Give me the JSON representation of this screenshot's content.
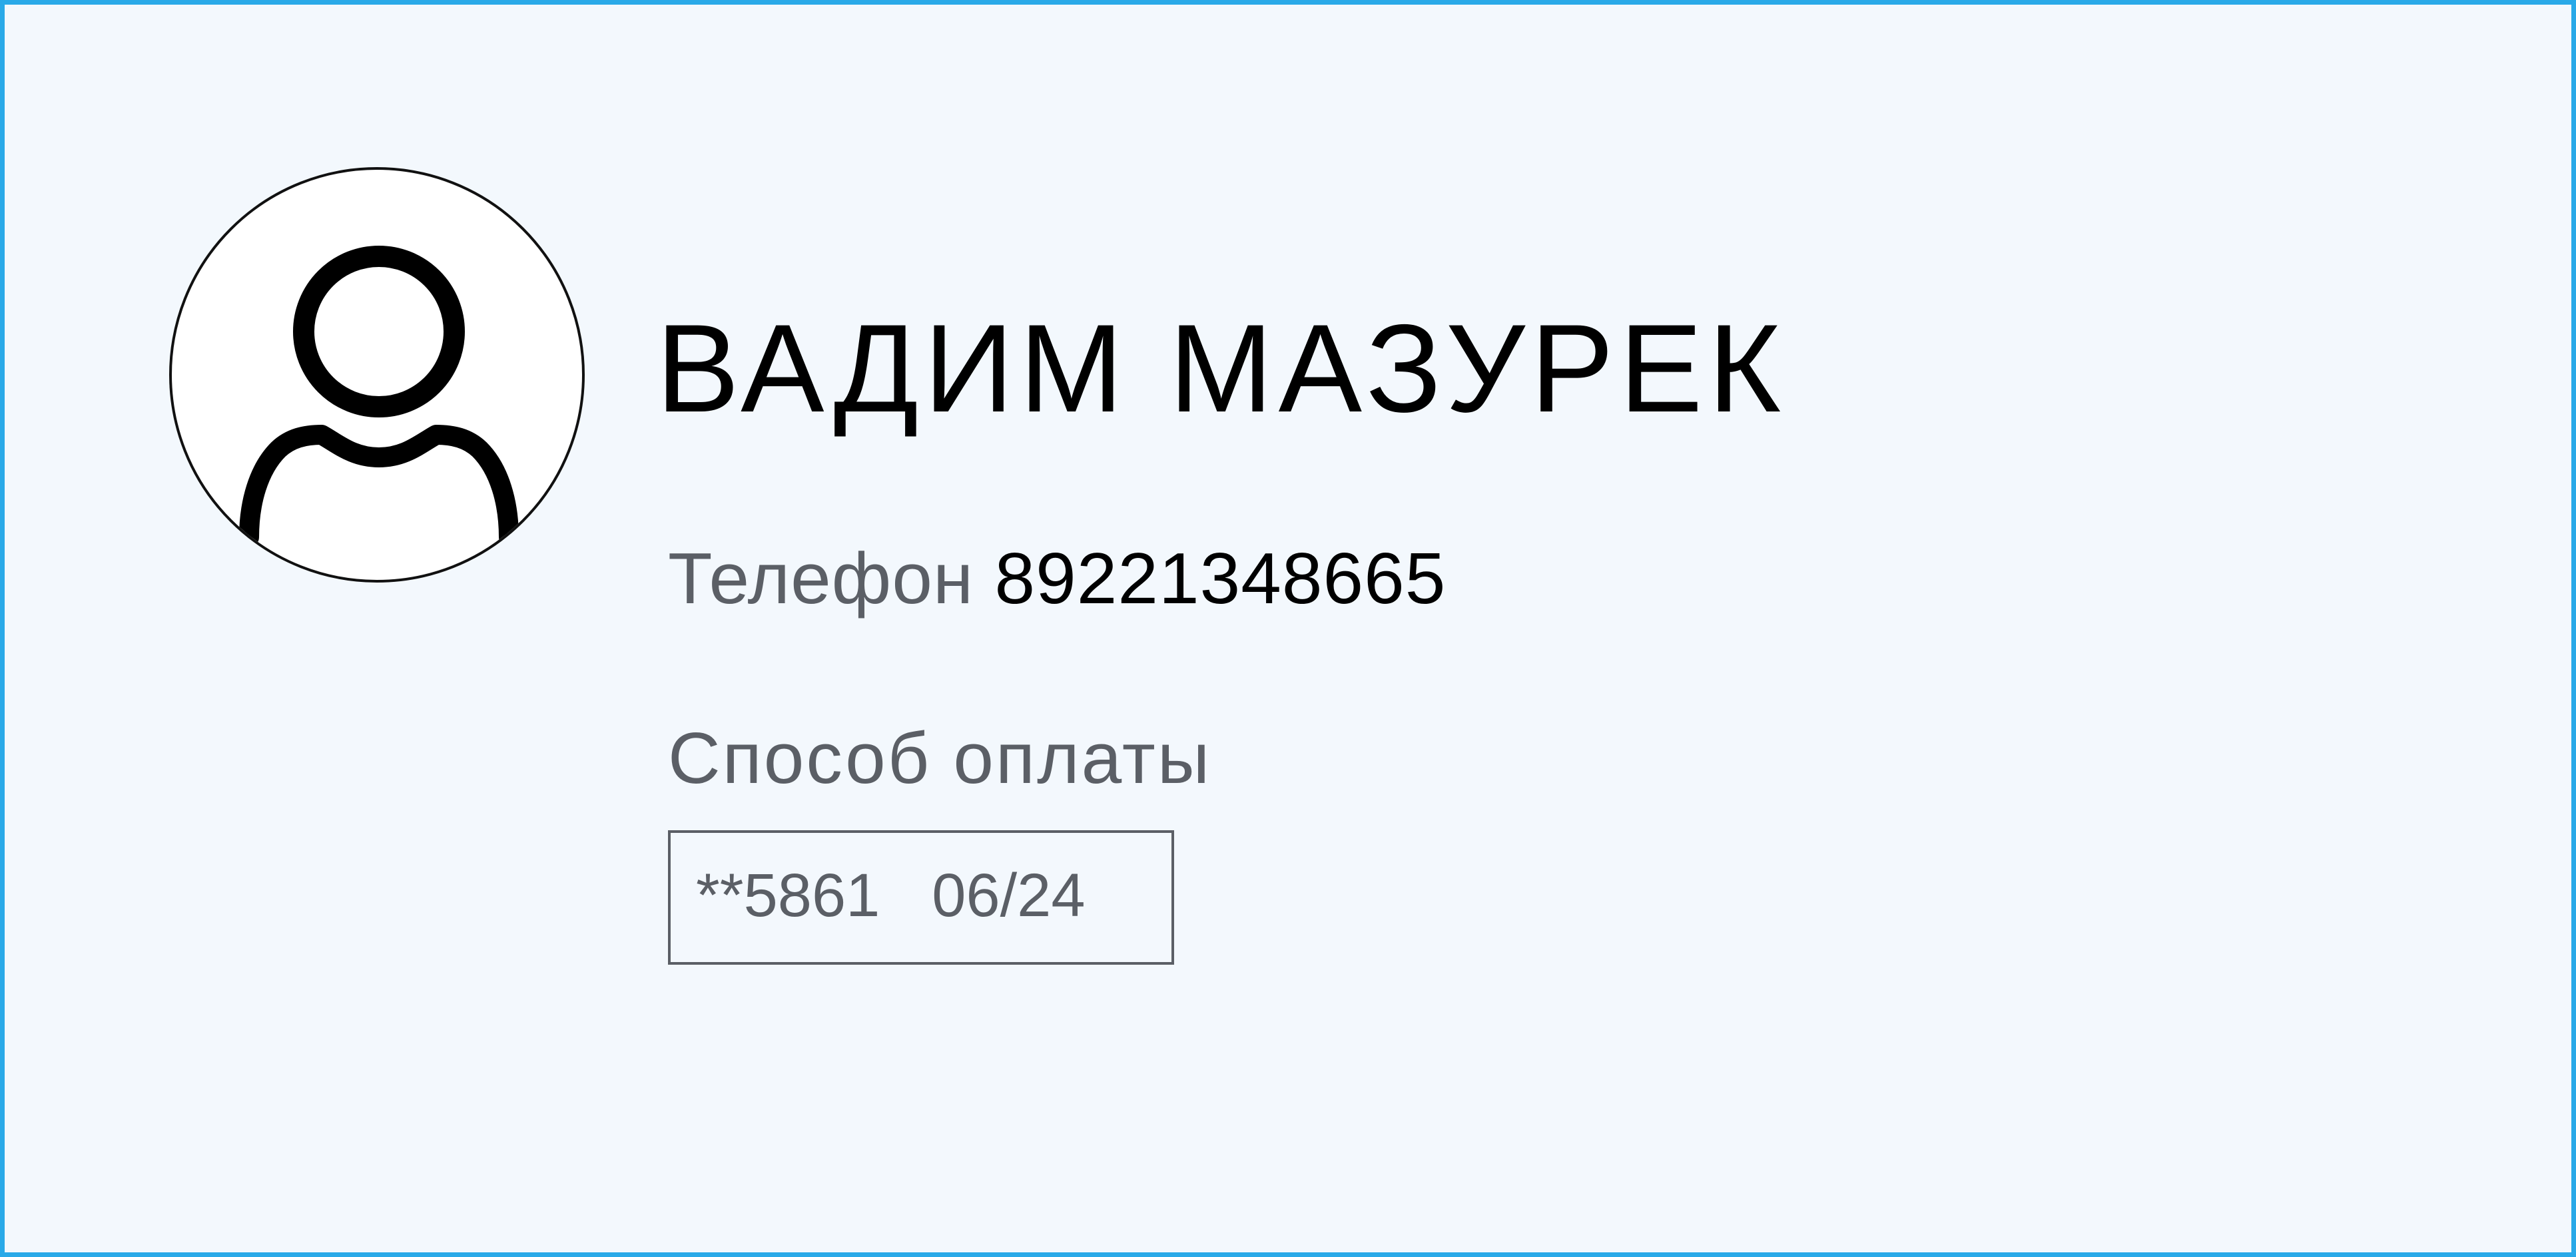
{
  "profile": {
    "name": "ВАДИМ МАЗУРЕК",
    "phone_label": "Телефон",
    "phone_value": "89221348665",
    "payment_title": "Способ оплаты",
    "card_number": "**5861",
    "card_expiry": "06/24",
    "avatar_icon": "user-avatar-icon"
  },
  "colors": {
    "border_accent": "#29a9e8",
    "background": "#f3f8fd",
    "muted_text": "#5b5f66",
    "primary_text": "#000000"
  }
}
